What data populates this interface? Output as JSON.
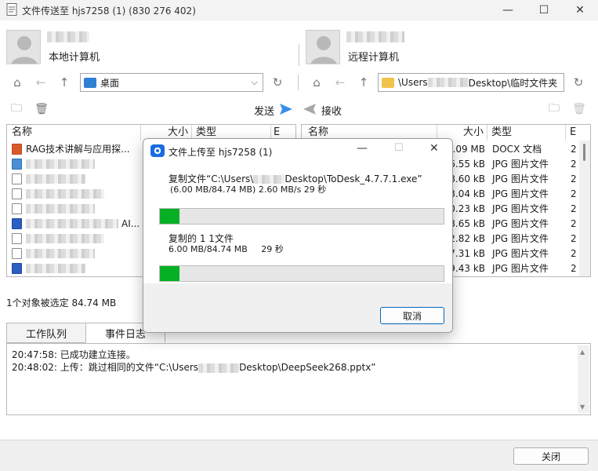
{
  "window": {
    "title": "文件传送至 hjs7258 (1) (830 276 402)",
    "minimize": "—",
    "maximize": "☐",
    "close": "✕"
  },
  "local": {
    "label": "本地计算机",
    "path": "桌面"
  },
  "remote": {
    "label": "远程计算机",
    "path_prefix": "\\Users",
    "path_suffix": "Desktop\\临时文件夹"
  },
  "toolbar": {
    "send": "发送",
    "receive": "接收"
  },
  "left_list": {
    "headers": {
      "name": "名称",
      "size": "大小",
      "type": "类型",
      "extra": "E"
    },
    "rows": [
      {
        "icon": "ppt-icon",
        "name": "RAG技术讲解与应用探..."
      },
      {
        "icon": "image-icon",
        "name": ""
      },
      {
        "icon": "file-icon",
        "name": ""
      },
      {
        "icon": "file-icon",
        "name": ""
      },
      {
        "icon": "file-icon",
        "name": ""
      },
      {
        "icon": "word-icon",
        "name": "AI..."
      },
      {
        "icon": "file-icon",
        "name": ""
      },
      {
        "icon": "file-icon",
        "name": ""
      },
      {
        "icon": "word-icon",
        "name": ""
      }
    ]
  },
  "right_list": {
    "headers": {
      "name": "名称",
      "size": "大小",
      "type": "类型",
      "extra": "E"
    },
    "rows": [
      {
        "size": "3.09 MB",
        "type": "DOCX 文档",
        "extra": "2"
      },
      {
        "size": "6.55 kB",
        "type": "JPG 图片文件",
        "extra": "2"
      },
      {
        "size": "8.60 kB",
        "type": "JPG 图片文件",
        "extra": "2"
      },
      {
        "size": "8.04 kB",
        "type": "JPG 图片文件",
        "extra": "2"
      },
      {
        "size": "0.23 kB",
        "type": "JPG 图片文件",
        "extra": "2"
      },
      {
        "size": "8.65 kB",
        "type": "JPG 图片文件",
        "extra": "2"
      },
      {
        "size": "2.82 kB",
        "type": "JPG 图片文件",
        "extra": "2"
      },
      {
        "size": "7.31 kB",
        "type": "JPG 图片文件",
        "extra": "2"
      },
      {
        "size": "9.43 kB",
        "type": "JPG 图片文件",
        "extra": "2"
      }
    ]
  },
  "status": {
    "selected": "1个对象被选定 84.74 MB"
  },
  "tabs": {
    "queue": "工作队列",
    "log": "事件日志"
  },
  "log": [
    {
      "time": "20:47:58:",
      "text": "已成功建立连接。"
    },
    {
      "time": "20:48:02:",
      "text": "上传：跳过相同的文件“C:\\Users",
      "text2": "Desktop\\DeepSeek268.pptx”"
    }
  ],
  "footer": {
    "close": "关闭"
  },
  "dialog": {
    "title": "文件上传至 hjs7258 (1)",
    "copy_file_label": "复制文件“C:\\Users\\",
    "copy_file_tail": "Desktop\\ToDesk_4.7.7.1.exe”",
    "file_stats": "(6.00 MB/84.74 MB)   2.60 MB/s  29 秒",
    "file_progress": 0.07,
    "copied_label": "复制的 1 1文件",
    "total_stats": "6.00 MB/84.74 MB     29 秒",
    "total_progress": 0.07,
    "cancel": "取消"
  },
  "colors": {
    "accent": "#06b025",
    "send_arrow": "#3a8ee6",
    "receive_arrow": "#9a9a9a"
  }
}
